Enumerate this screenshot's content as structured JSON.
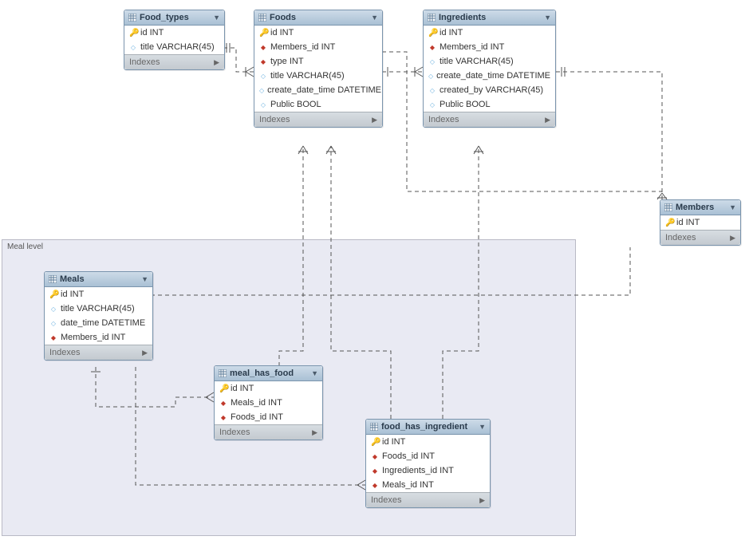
{
  "region": {
    "label": "Meal level"
  },
  "indexes_label": "Indexes",
  "tables": {
    "food_types": {
      "title": "Food_types",
      "cols": [
        {
          "icon": "key",
          "text": "id INT"
        },
        {
          "icon": "attr",
          "text": "title VARCHAR(45)"
        }
      ]
    },
    "foods": {
      "title": "Foods",
      "cols": [
        {
          "icon": "key",
          "text": "id INT"
        },
        {
          "icon": "fk",
          "text": "Members_id INT"
        },
        {
          "icon": "fk",
          "text": "type INT"
        },
        {
          "icon": "attr",
          "text": "title VARCHAR(45)"
        },
        {
          "icon": "attr",
          "text": "create_date_time DATETIME"
        },
        {
          "icon": "attr",
          "text": "Public BOOL"
        }
      ]
    },
    "ingredients": {
      "title": "Ingredients",
      "cols": [
        {
          "icon": "key",
          "text": "id INT"
        },
        {
          "icon": "fk",
          "text": "Members_id INT"
        },
        {
          "icon": "attr",
          "text": "title VARCHAR(45)"
        },
        {
          "icon": "attr",
          "text": "create_date_time DATETIME"
        },
        {
          "icon": "attr",
          "text": "created_by VARCHAR(45)"
        },
        {
          "icon": "attr",
          "text": "Public BOOL"
        }
      ]
    },
    "members": {
      "title": "Members",
      "cols": [
        {
          "icon": "key",
          "text": "id INT"
        }
      ]
    },
    "meals": {
      "title": "Meals",
      "cols": [
        {
          "icon": "key",
          "text": "id INT"
        },
        {
          "icon": "attr",
          "text": "title VARCHAR(45)"
        },
        {
          "icon": "attr",
          "text": "date_time DATETIME"
        },
        {
          "icon": "fk",
          "text": "Members_id INT"
        }
      ]
    },
    "meal_has_food": {
      "title": "meal_has_food",
      "cols": [
        {
          "icon": "key",
          "text": "id INT"
        },
        {
          "icon": "fk",
          "text": "Meals_id INT"
        },
        {
          "icon": "fk",
          "text": "Foods_id INT"
        }
      ]
    },
    "food_has_ingredient": {
      "title": "food_has_ingredient",
      "cols": [
        {
          "icon": "key",
          "text": "id INT"
        },
        {
          "icon": "fk",
          "text": "Foods_id INT"
        },
        {
          "icon": "fk",
          "text": "Ingredients_id INT"
        },
        {
          "icon": "fk",
          "text": "Meals_id INT"
        }
      ]
    }
  }
}
